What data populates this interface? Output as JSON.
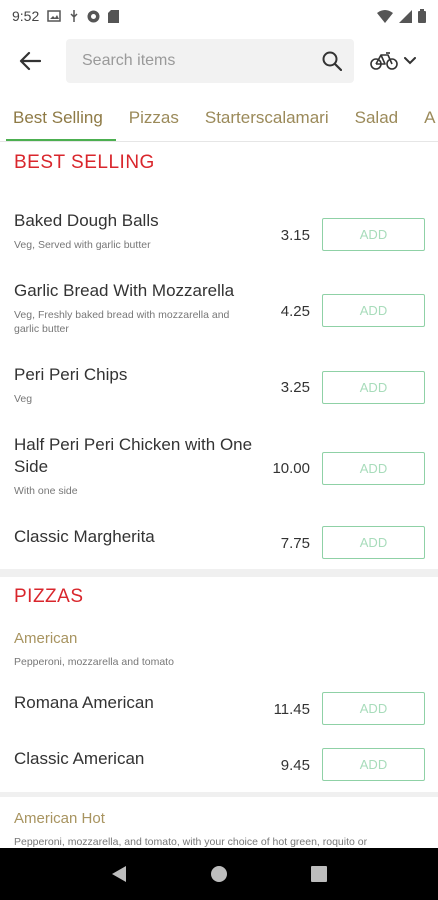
{
  "status": {
    "time": "9:52"
  },
  "search": {
    "placeholder": "Search items"
  },
  "tabs": [
    {
      "label": "Best Selling"
    },
    {
      "label": "Pizzas"
    },
    {
      "label": "Starterscalamari"
    },
    {
      "label": "Salad"
    },
    {
      "label": "A"
    }
  ],
  "sections": [
    {
      "title": "BEST SELLING",
      "items": [
        {
          "name": "Baked Dough Balls",
          "desc": "Veg, Served with garlic butter",
          "price": "3.15",
          "add": "ADD"
        },
        {
          "name": "Garlic Bread With Mozzarella",
          "desc": "Veg, Freshly baked bread with mozzarella and garlic butter",
          "price": "4.25",
          "add": "ADD"
        },
        {
          "name": "Peri Peri Chips",
          "desc": "Veg",
          "price": "3.25",
          "add": "ADD"
        },
        {
          "name": "Half Peri Peri Chicken with One Side",
          "desc": "With one side",
          "price": "10.00",
          "add": "ADD"
        },
        {
          "name": "Classic Margherita",
          "desc": "",
          "price": "7.75",
          "add": "ADD"
        }
      ]
    },
    {
      "title": "PIZZAS",
      "subcategories": [
        {
          "name": "American",
          "desc": "Pepperoni, mozzarella and tomato",
          "items": [
            {
              "name": "Romana American",
              "price": "11.45",
              "add": "ADD"
            },
            {
              "name": "Classic American",
              "price": "9.45",
              "add": "ADD"
            }
          ]
        },
        {
          "name": "American Hot",
          "desc": "Pepperoni, mozzarella, and tomato, with your choice of hot green, roquito or"
        }
      ]
    }
  ],
  "colors": {
    "accent_red": "#d9262c",
    "add_green": "#8fd1a6",
    "tab_gold": "#9b8a5a",
    "tab_underline": "#4caf50"
  },
  "icons": {
    "back": "arrow-left-icon",
    "search": "search-icon",
    "veg_filter": "bicycle-icon",
    "dropdown": "chevron-down-icon"
  }
}
